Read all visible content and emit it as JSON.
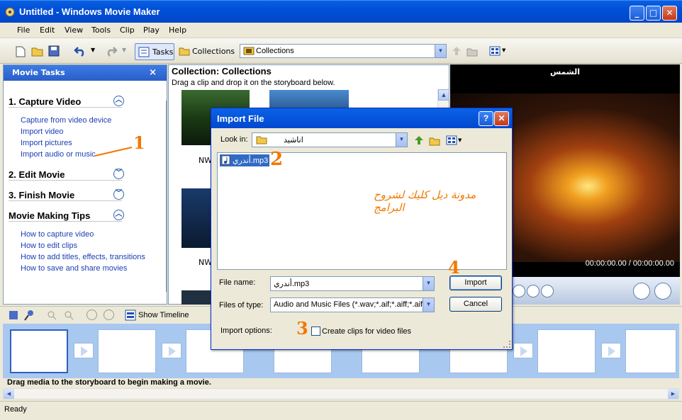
{
  "window": {
    "title": "Untitled - Windows Movie Maker",
    "min": "_",
    "max": "□",
    "close": "✕"
  },
  "menu": [
    "File",
    "Edit",
    "View",
    "Tools",
    "Clip",
    "Play",
    "Help"
  ],
  "toolbar": {
    "tasks": "Tasks",
    "collections": "Collections",
    "collection_select": "Collections"
  },
  "tasks_panel": {
    "title": "Movie Tasks",
    "close": "×",
    "sections": [
      {
        "title": "1. Capture Video",
        "links": [
          "Capture from video device",
          "Import video",
          "Import pictures",
          "Import audio or music"
        ]
      },
      {
        "title": "2. Edit Movie",
        "links": []
      },
      {
        "title": "3. Finish Movie",
        "links": []
      },
      {
        "title": "Movie Making Tips",
        "links": [
          "How to capture video",
          "How to edit clips",
          "How to add titles, effects, transitions",
          "How to save and share movies"
        ]
      }
    ]
  },
  "collection": {
    "title": "Collection: Collections",
    "subtitle": "Drag a clip and drop it on the storyboard below.",
    "labels": [
      "NW",
      "NW"
    ]
  },
  "preview": {
    "title": "الشمس",
    "time": "00:00:00.00 / 00:00:00.00"
  },
  "dialog": {
    "title": "Import File",
    "help": "?",
    "close": "✕",
    "look_in_label": "Look in:",
    "look_in_value": "اناشيد",
    "file_item": "أندري.mp3",
    "watermark": "مدونة ديل كليك لشروح البرامج",
    "file_name_label": "File name:",
    "file_name_value": "أندري.mp3",
    "file_type_label": "Files of type:",
    "file_type_value": "Audio and Music Files (*.wav;*.aif;*.aiff;*.aifc",
    "import_button": "Import",
    "cancel_button": "Cancel",
    "import_options_label": "Import options:",
    "checkbox_label": "Create clips for video files"
  },
  "annotations": [
    "1",
    "2",
    "3",
    "4"
  ],
  "timeline_toolbar": {
    "show_timeline": "Show Timeline"
  },
  "storyboard": {
    "hint": "Drag media to the storyboard to begin making a movie."
  },
  "status": "Ready",
  "colors": {
    "titlebar": "#0050d8",
    "annotation": "#f07800",
    "link": "#1a3fb5",
    "storyboard": "#a8c8f0"
  }
}
